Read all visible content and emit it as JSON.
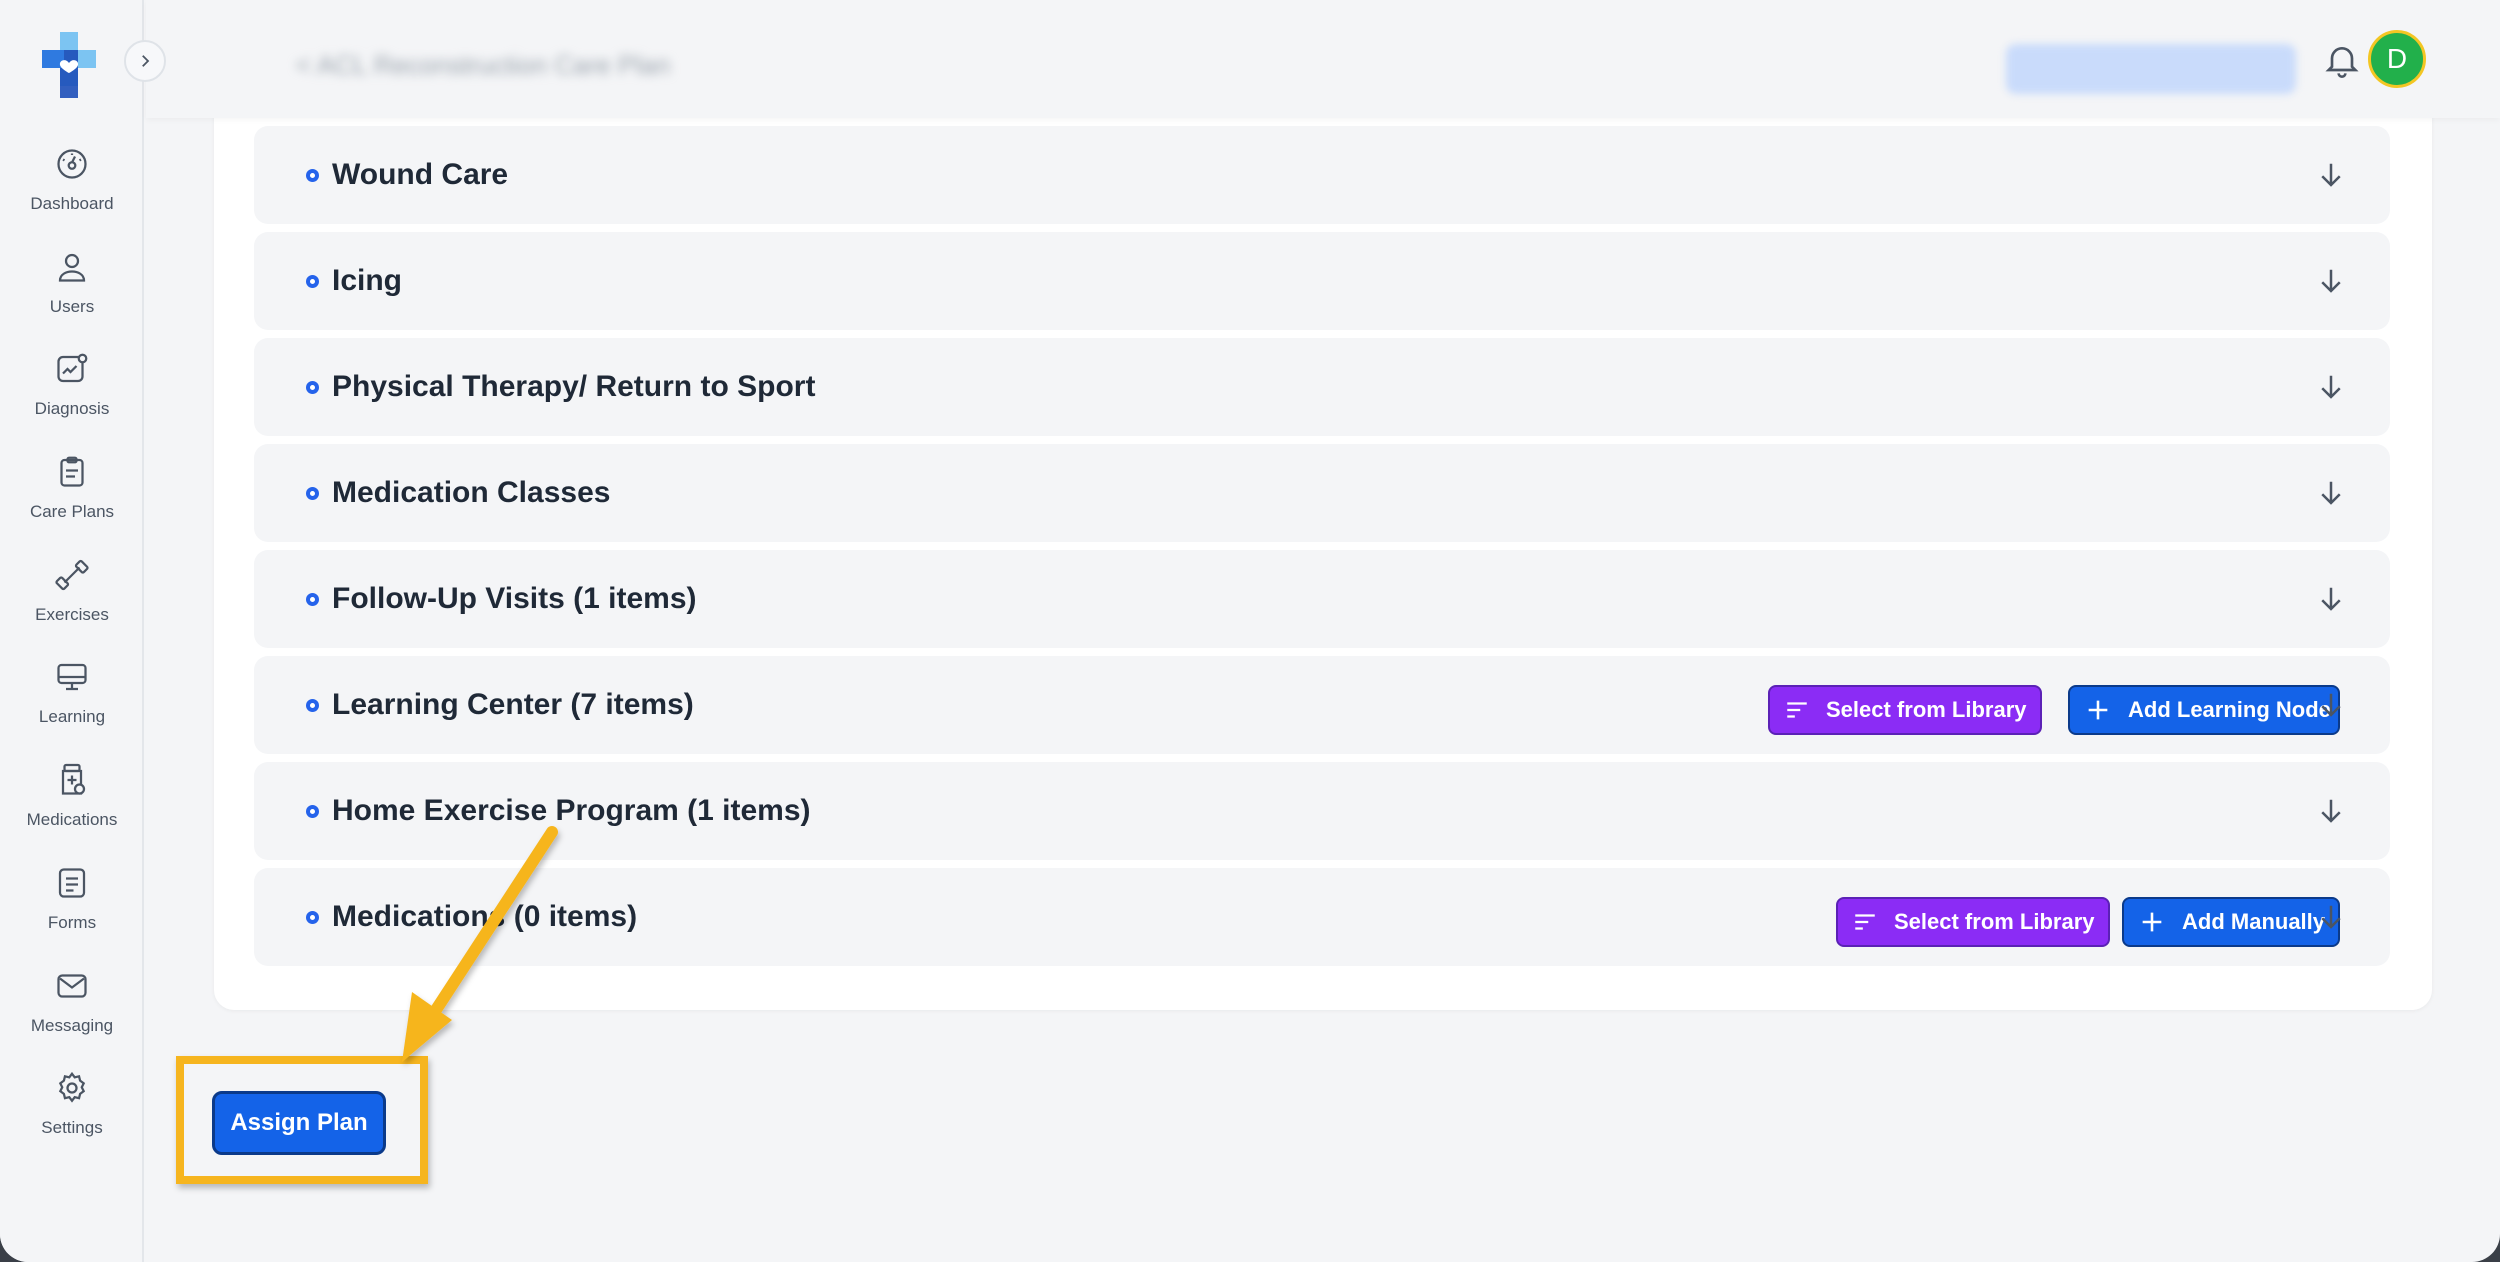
{
  "sidebar": {
    "items": [
      {
        "label": "Dashboard",
        "icon": "dashboard-icon"
      },
      {
        "label": "Users",
        "icon": "user-icon"
      },
      {
        "label": "Diagnosis",
        "icon": "diagnosis-icon"
      },
      {
        "label": "Care Plans",
        "icon": "clipboard-icon"
      },
      {
        "label": "Exercises",
        "icon": "dumbbell-icon"
      },
      {
        "label": "Learning",
        "icon": "monitor-icon"
      },
      {
        "label": "Medications",
        "icon": "medication-bottle-icon"
      },
      {
        "label": "Forms",
        "icon": "document-icon"
      },
      {
        "label": "Messaging",
        "icon": "envelope-icon"
      },
      {
        "label": "Settings",
        "icon": "gear-icon"
      }
    ]
  },
  "header": {
    "breadcrumb": "< ACL Reconstruction Care Plan",
    "avatar_initial": "D",
    "avatar_color": "#22b04b"
  },
  "sections": [
    {
      "title": "Wound Care"
    },
    {
      "title": "Icing"
    },
    {
      "title": "Physical Therapy/ Return to Sport"
    },
    {
      "title": "Medication Classes"
    },
    {
      "title": "Follow-Up Visits (1 items)"
    },
    {
      "title": "Learning Center (7 items)",
      "actions": {
        "library": "Select from Library",
        "add": "Add Learning Node"
      }
    },
    {
      "title": "Home Exercise Program (1 items)"
    },
    {
      "title": "Medications (0 items)",
      "actions": {
        "library": "Select from Library",
        "add": "Add Manually"
      }
    }
  ],
  "footer": {
    "assign_label": "Assign Plan"
  },
  "colors": {
    "primary": "#1463e8",
    "purple": "#8b2cf5",
    "annotation": "#f6b51f"
  }
}
